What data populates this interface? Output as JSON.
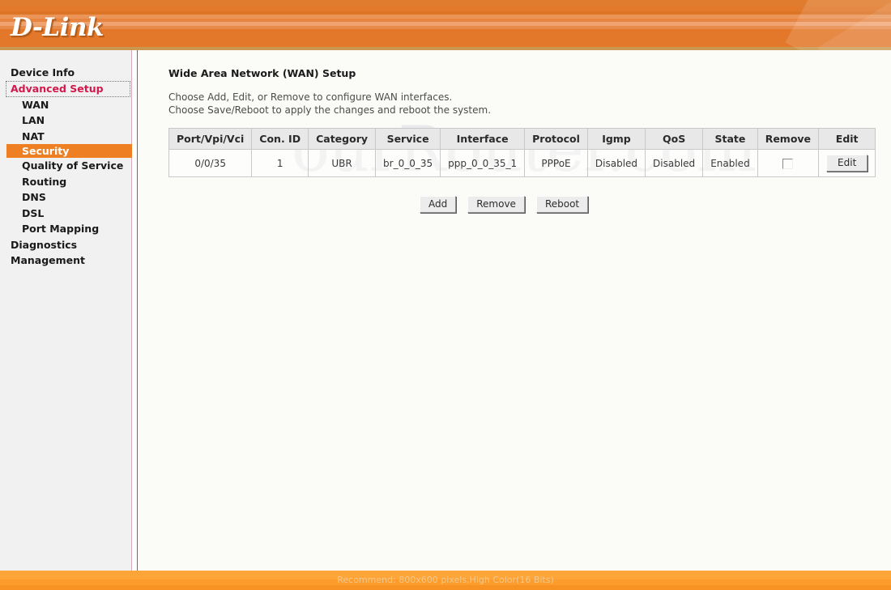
{
  "banner": {
    "logo": "D-Link"
  },
  "sidebar": {
    "items": [
      {
        "label": "Device Info",
        "level": "top",
        "state": "normal"
      },
      {
        "label": "Advanced Setup",
        "level": "top",
        "state": "focused"
      },
      {
        "label": "WAN",
        "level": "sub",
        "state": "normal"
      },
      {
        "label": "LAN",
        "level": "sub",
        "state": "normal"
      },
      {
        "label": "NAT",
        "level": "sub",
        "state": "normal"
      },
      {
        "label": "Security",
        "level": "sub",
        "state": "active"
      },
      {
        "label": "Quality of Service",
        "level": "sub",
        "state": "normal"
      },
      {
        "label": "Routing",
        "level": "sub",
        "state": "normal"
      },
      {
        "label": "DNS",
        "level": "sub",
        "state": "normal"
      },
      {
        "label": "DSL",
        "level": "sub",
        "state": "normal"
      },
      {
        "label": "Port Mapping",
        "level": "sub",
        "state": "normal"
      },
      {
        "label": "Diagnostics",
        "level": "top",
        "state": "normal"
      },
      {
        "label": "Management",
        "level": "top",
        "state": "normal"
      }
    ]
  },
  "main": {
    "title": "Wide Area Network (WAN) Setup",
    "description_line1": "Choose Add, Edit, or Remove to configure WAN interfaces.",
    "description_line2": "Choose Save/Reboot to apply the changes and reboot the system.",
    "watermark": "ourRouter.com",
    "table": {
      "columns": [
        "Port/Vpi/Vci",
        "Con. ID",
        "Category",
        "Service",
        "Interface",
        "Protocol",
        "Igmp",
        "QoS",
        "State",
        "Remove",
        "Edit"
      ],
      "rows": [
        {
          "port_vpi_vci": "0/0/35",
          "con_id": "1",
          "category": "UBR",
          "service": "br_0_0_35",
          "interface": "ppp_0_0_35_1",
          "protocol": "PPPoE",
          "igmp": "Disabled",
          "qos": "Disabled",
          "state": "Enabled",
          "remove_checked": false,
          "edit_label": "Edit"
        }
      ]
    },
    "actions": [
      {
        "label": "Add"
      },
      {
        "label": "Remove"
      },
      {
        "label": "Reboot"
      }
    ]
  },
  "footer": {
    "text": "Recommend: 800x600 pixels,High Color(16 Bits)"
  },
  "colors": {
    "brand_orange": "#e3782a",
    "highlight_orange": "#ee7f22",
    "focus_red": "#d2194b",
    "footer_orange": "#fb9c2c"
  }
}
